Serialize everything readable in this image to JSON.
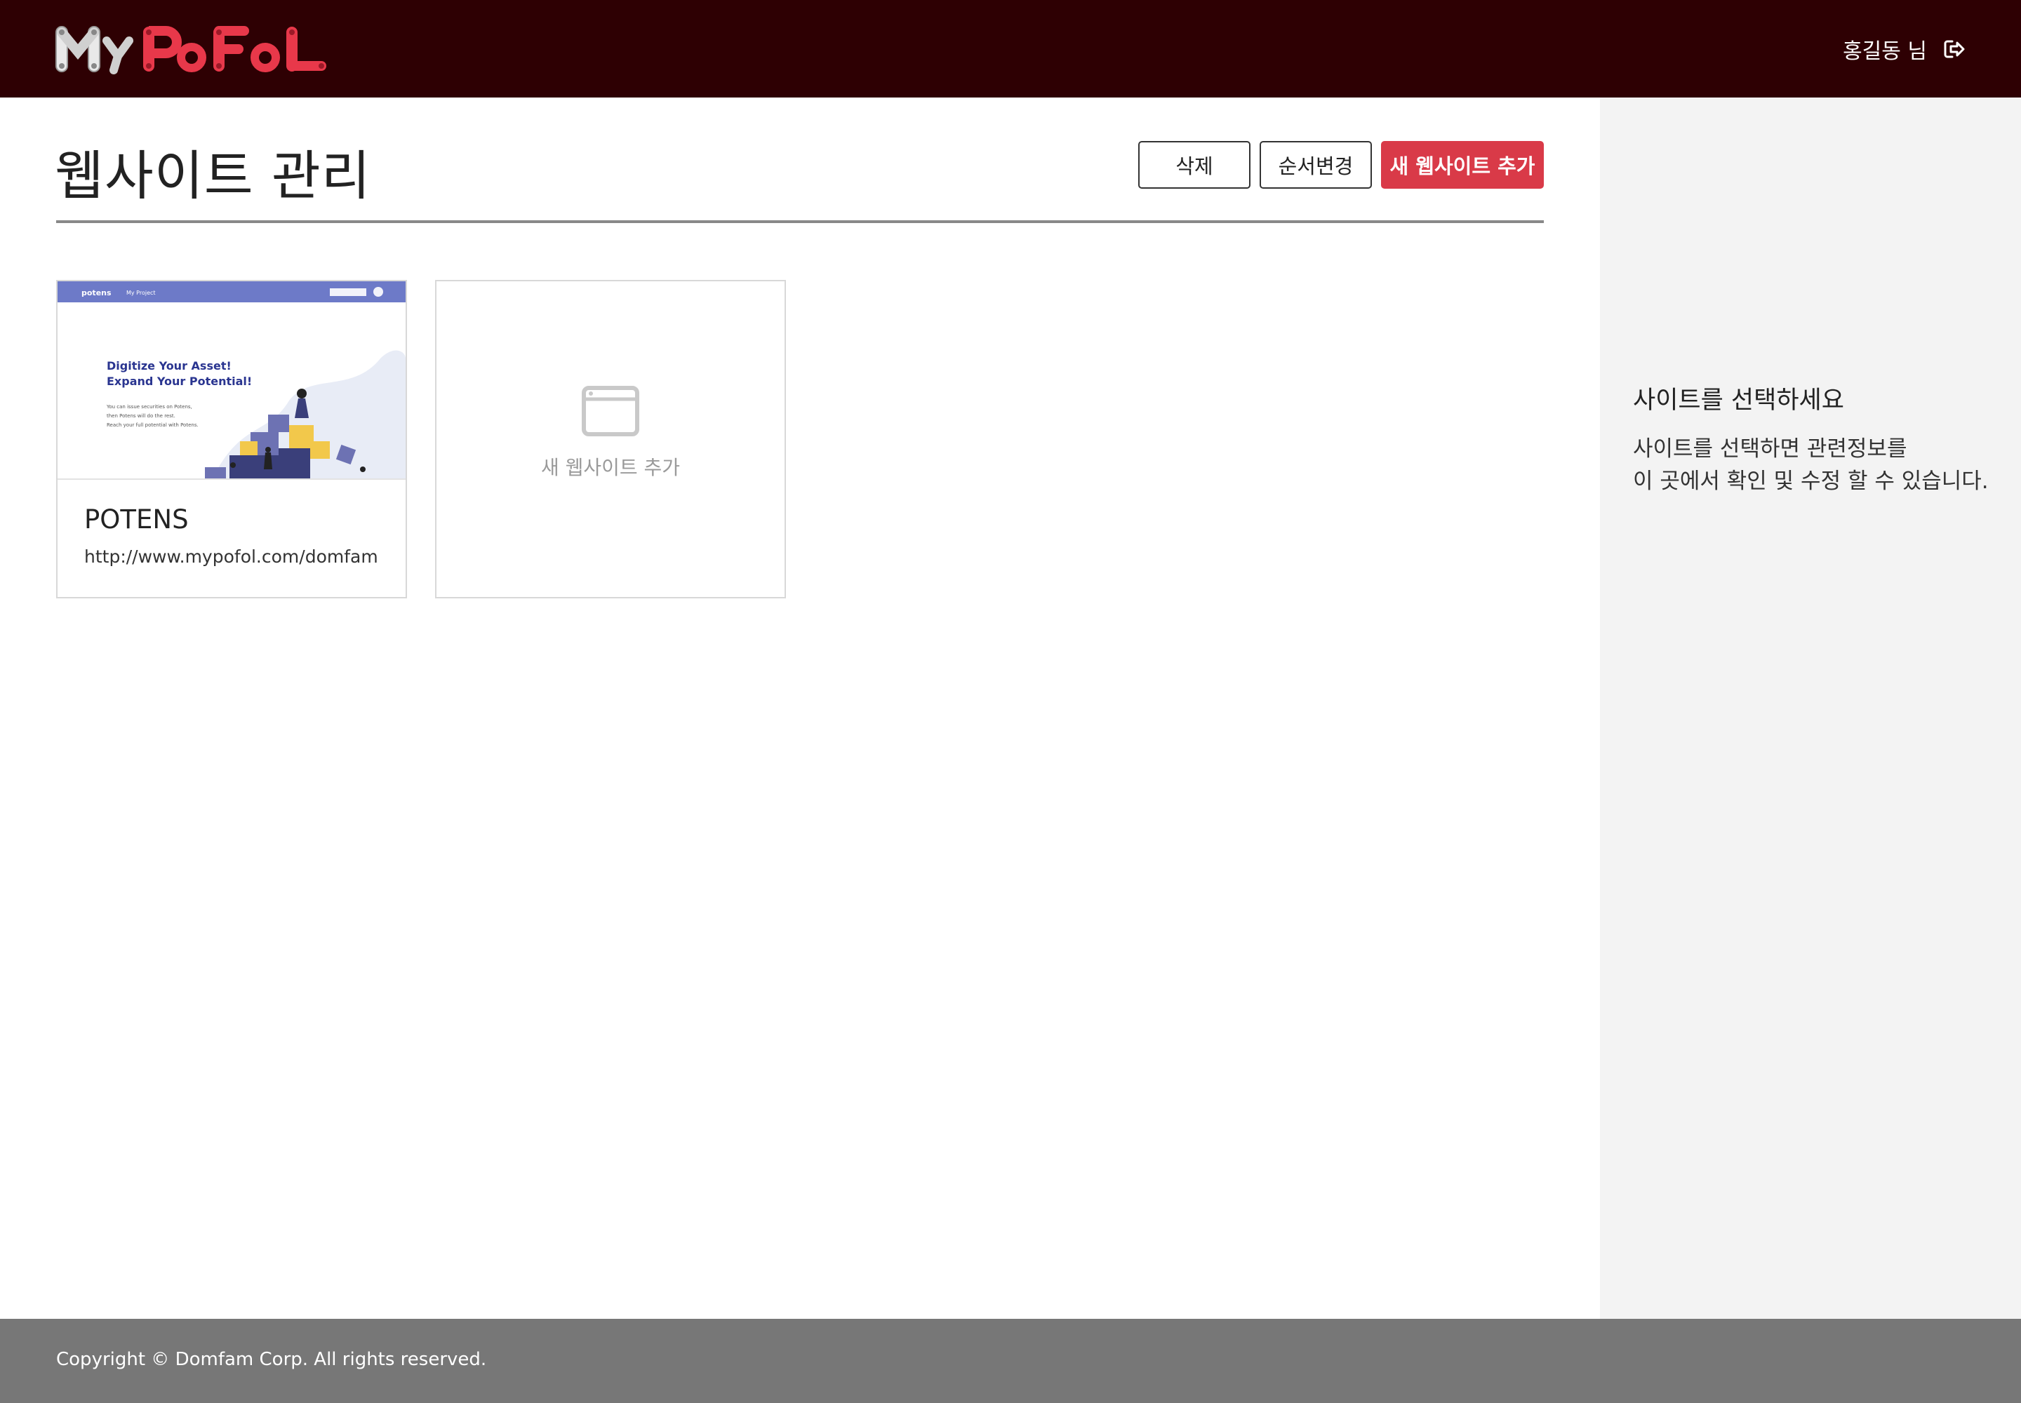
{
  "header": {
    "brand": "MyPoFoL",
    "user_name": "홍길동 님",
    "logout_icon": "sign-out-icon"
  },
  "main": {
    "title": "웹사이트 관리",
    "buttons": {
      "delete": "삭제",
      "reorder": "순서변경",
      "add": "새 웹사이트 추가"
    },
    "sites": [
      {
        "name": "POTENS",
        "url": "http://www.mypofol.com/domfam",
        "thumbnail": {
          "brand": "potens",
          "nav": "My Project",
          "headline1": "Digitize Your Asset!",
          "headline2": "Expand Your Potential!",
          "body1": "You can issue securities on Potens,",
          "body2": "then Potens will do the rest.",
          "body3": "Reach your full potential with Potens."
        }
      }
    ],
    "new_site": {
      "label": "새 웹사이트 추가",
      "icon": "browser-window-icon"
    }
  },
  "sidebar": {
    "title": "사이트를 선택하세요",
    "desc_line1": "사이트를 선택하면 관련정보를",
    "desc_line2": "이 곳에서 확인 및 수정 할 수 있습니다."
  },
  "footer": {
    "copyright": "Copyright © Domfam Corp. All rights reserved."
  },
  "colors": {
    "header_bg": "#2e0003",
    "accent": "#d93a48",
    "sidebar_bg": "#f3f3f3",
    "footer_bg": "#777777"
  }
}
